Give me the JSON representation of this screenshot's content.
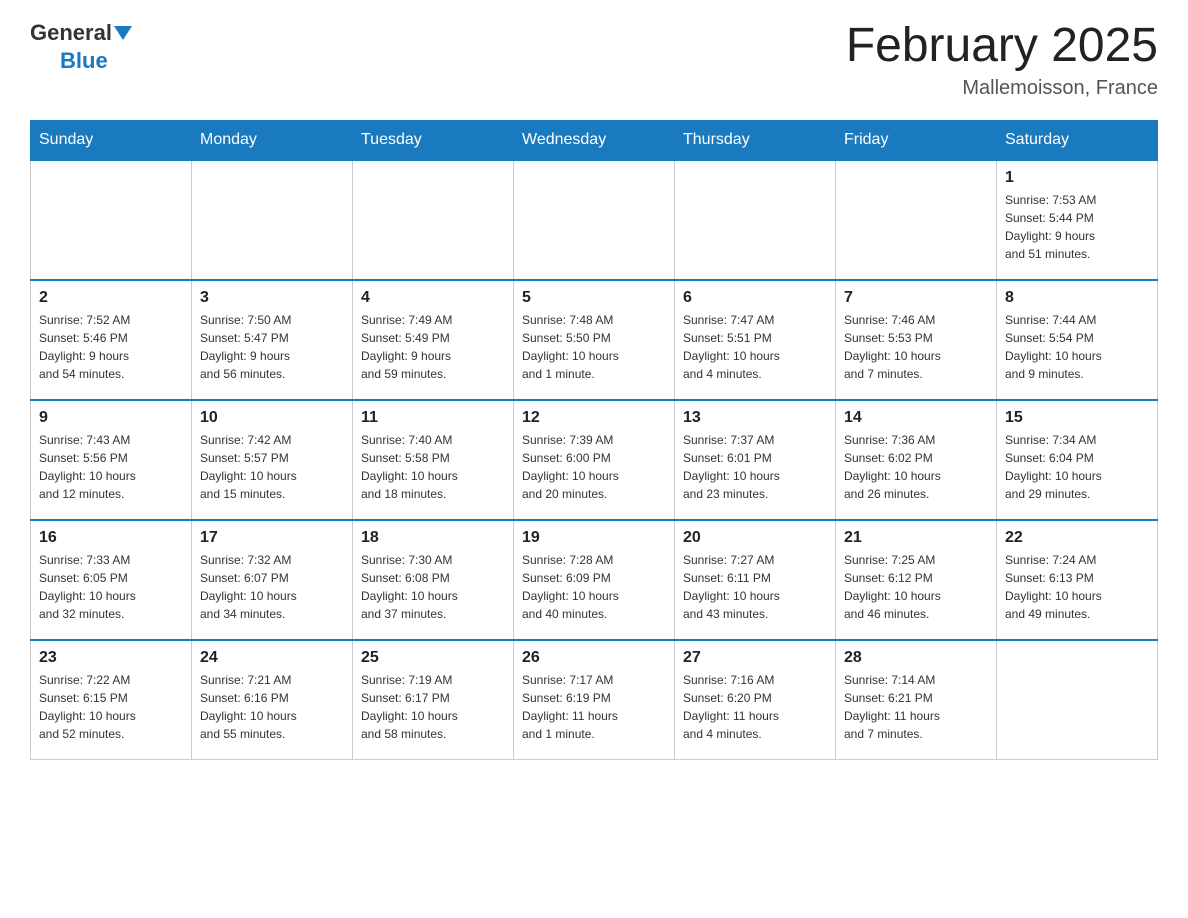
{
  "header": {
    "logo_general": "General",
    "logo_blue": "Blue",
    "month_title": "February 2025",
    "location": "Mallemoisson, France"
  },
  "weekdays": [
    "Sunday",
    "Monday",
    "Tuesday",
    "Wednesday",
    "Thursday",
    "Friday",
    "Saturday"
  ],
  "weeks": [
    [
      {
        "day": "",
        "info": ""
      },
      {
        "day": "",
        "info": ""
      },
      {
        "day": "",
        "info": ""
      },
      {
        "day": "",
        "info": ""
      },
      {
        "day": "",
        "info": ""
      },
      {
        "day": "",
        "info": ""
      },
      {
        "day": "1",
        "info": "Sunrise: 7:53 AM\nSunset: 5:44 PM\nDaylight: 9 hours\nand 51 minutes."
      }
    ],
    [
      {
        "day": "2",
        "info": "Sunrise: 7:52 AM\nSunset: 5:46 PM\nDaylight: 9 hours\nand 54 minutes."
      },
      {
        "day": "3",
        "info": "Sunrise: 7:50 AM\nSunset: 5:47 PM\nDaylight: 9 hours\nand 56 minutes."
      },
      {
        "day": "4",
        "info": "Sunrise: 7:49 AM\nSunset: 5:49 PM\nDaylight: 9 hours\nand 59 minutes."
      },
      {
        "day": "5",
        "info": "Sunrise: 7:48 AM\nSunset: 5:50 PM\nDaylight: 10 hours\nand 1 minute."
      },
      {
        "day": "6",
        "info": "Sunrise: 7:47 AM\nSunset: 5:51 PM\nDaylight: 10 hours\nand 4 minutes."
      },
      {
        "day": "7",
        "info": "Sunrise: 7:46 AM\nSunset: 5:53 PM\nDaylight: 10 hours\nand 7 minutes."
      },
      {
        "day": "8",
        "info": "Sunrise: 7:44 AM\nSunset: 5:54 PM\nDaylight: 10 hours\nand 9 minutes."
      }
    ],
    [
      {
        "day": "9",
        "info": "Sunrise: 7:43 AM\nSunset: 5:56 PM\nDaylight: 10 hours\nand 12 minutes."
      },
      {
        "day": "10",
        "info": "Sunrise: 7:42 AM\nSunset: 5:57 PM\nDaylight: 10 hours\nand 15 minutes."
      },
      {
        "day": "11",
        "info": "Sunrise: 7:40 AM\nSunset: 5:58 PM\nDaylight: 10 hours\nand 18 minutes."
      },
      {
        "day": "12",
        "info": "Sunrise: 7:39 AM\nSunset: 6:00 PM\nDaylight: 10 hours\nand 20 minutes."
      },
      {
        "day": "13",
        "info": "Sunrise: 7:37 AM\nSunset: 6:01 PM\nDaylight: 10 hours\nand 23 minutes."
      },
      {
        "day": "14",
        "info": "Sunrise: 7:36 AM\nSunset: 6:02 PM\nDaylight: 10 hours\nand 26 minutes."
      },
      {
        "day": "15",
        "info": "Sunrise: 7:34 AM\nSunset: 6:04 PM\nDaylight: 10 hours\nand 29 minutes."
      }
    ],
    [
      {
        "day": "16",
        "info": "Sunrise: 7:33 AM\nSunset: 6:05 PM\nDaylight: 10 hours\nand 32 minutes."
      },
      {
        "day": "17",
        "info": "Sunrise: 7:32 AM\nSunset: 6:07 PM\nDaylight: 10 hours\nand 34 minutes."
      },
      {
        "day": "18",
        "info": "Sunrise: 7:30 AM\nSunset: 6:08 PM\nDaylight: 10 hours\nand 37 minutes."
      },
      {
        "day": "19",
        "info": "Sunrise: 7:28 AM\nSunset: 6:09 PM\nDaylight: 10 hours\nand 40 minutes."
      },
      {
        "day": "20",
        "info": "Sunrise: 7:27 AM\nSunset: 6:11 PM\nDaylight: 10 hours\nand 43 minutes."
      },
      {
        "day": "21",
        "info": "Sunrise: 7:25 AM\nSunset: 6:12 PM\nDaylight: 10 hours\nand 46 minutes."
      },
      {
        "day": "22",
        "info": "Sunrise: 7:24 AM\nSunset: 6:13 PM\nDaylight: 10 hours\nand 49 minutes."
      }
    ],
    [
      {
        "day": "23",
        "info": "Sunrise: 7:22 AM\nSunset: 6:15 PM\nDaylight: 10 hours\nand 52 minutes."
      },
      {
        "day": "24",
        "info": "Sunrise: 7:21 AM\nSunset: 6:16 PM\nDaylight: 10 hours\nand 55 minutes."
      },
      {
        "day": "25",
        "info": "Sunrise: 7:19 AM\nSunset: 6:17 PM\nDaylight: 10 hours\nand 58 minutes."
      },
      {
        "day": "26",
        "info": "Sunrise: 7:17 AM\nSunset: 6:19 PM\nDaylight: 11 hours\nand 1 minute."
      },
      {
        "day": "27",
        "info": "Sunrise: 7:16 AM\nSunset: 6:20 PM\nDaylight: 11 hours\nand 4 minutes."
      },
      {
        "day": "28",
        "info": "Sunrise: 7:14 AM\nSunset: 6:21 PM\nDaylight: 11 hours\nand 7 minutes."
      },
      {
        "day": "",
        "info": ""
      }
    ]
  ]
}
